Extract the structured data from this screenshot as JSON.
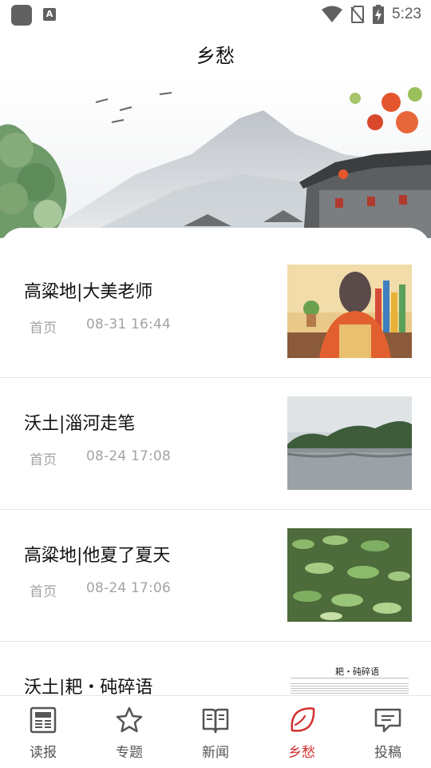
{
  "status_bar": {
    "time": "5:23"
  },
  "header": {
    "title": "乡愁"
  },
  "articles": [
    {
      "title": "高粱地|大美老师",
      "source": "首页",
      "date": "08-31  16:44"
    },
    {
      "title": "沃土|淄河走笔",
      "source": "首页",
      "date": "08-24  17:08"
    },
    {
      "title": "高粱地|他夏了夏天",
      "source": "首页",
      "date": "08-24  17:06"
    },
    {
      "title": "沃土|耙・砘碎语",
      "source": "",
      "date": "",
      "thumb_title": "耙・砘碎语"
    }
  ],
  "tabbar": {
    "active_color": "#d32f2f",
    "inactive_color": "#555555",
    "tabs": [
      {
        "label": "读报",
        "icon": "newspaper-icon"
      },
      {
        "label": "专题",
        "icon": "star-icon"
      },
      {
        "label": "新闻",
        "icon": "book-icon"
      },
      {
        "label": "乡愁",
        "icon": "leaf-icon",
        "active": true
      },
      {
        "label": "投稿",
        "icon": "message-icon"
      }
    ]
  }
}
